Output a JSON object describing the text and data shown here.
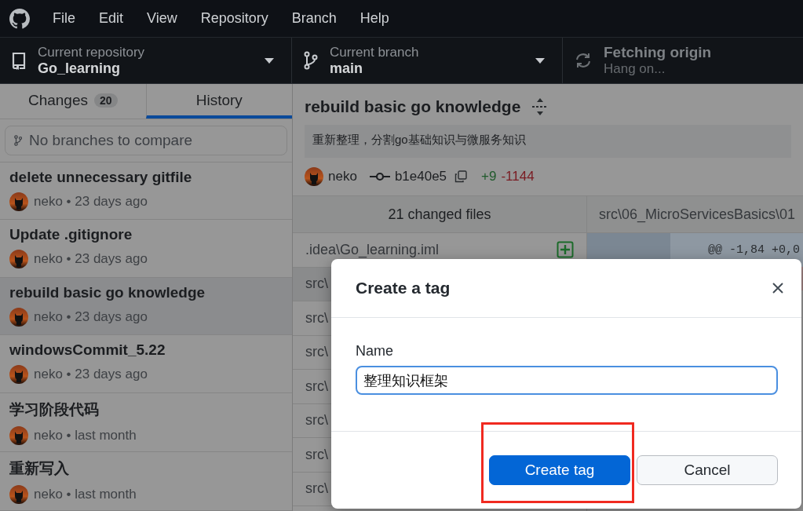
{
  "menu": [
    "File",
    "Edit",
    "View",
    "Repository",
    "Branch",
    "Help"
  ],
  "toolbar": {
    "repository": {
      "label": "Current repository",
      "value": "Go_learning"
    },
    "branch": {
      "label": "Current branch",
      "value": "main"
    },
    "fetch": {
      "label": "Fetching origin",
      "status": "Hang on..."
    }
  },
  "tabs": [
    {
      "label": "Changes",
      "count": "20",
      "selected": false
    },
    {
      "label": "History",
      "selected": true
    }
  ],
  "compare": {
    "placeholder": "No branches to compare"
  },
  "commits": [
    {
      "title": "delete unnecessary gitfile",
      "meta": "neko • 23 days ago",
      "selected": false
    },
    {
      "title": "Update .gitignore",
      "meta": "neko • 23 days ago",
      "selected": false
    },
    {
      "title": "rebuild basic go knowledge",
      "meta": "neko • 23 days ago",
      "selected": true
    },
    {
      "title": "windowsCommit_5.22",
      "meta": "neko • 23 days ago",
      "selected": false
    },
    {
      "title": "学习阶段代码",
      "meta": "neko • last month",
      "selected": false
    },
    {
      "title": "重新写入",
      "meta": "neko • last month",
      "selected": false
    }
  ],
  "commit": {
    "title": "rebuild basic go knowledge",
    "description": "重新整理，分割go基础知识与微服务知识",
    "author": "neko",
    "sha": "b1e40e5",
    "additions": "+9",
    "deletions": "-1144"
  },
  "files": {
    "header": "21 changed files",
    "items": [
      {
        "path": ".idea\\Go_learning.iml",
        "kind": "added",
        "selected": false
      },
      {
        "path": "src\\",
        "selected": true
      },
      {
        "path": "src\\",
        "selected": false
      },
      {
        "path": "src\\",
        "selected": false
      },
      {
        "path": "src\\",
        "selected": false
      },
      {
        "path": "src\\",
        "selected": false
      },
      {
        "path": "src\\",
        "selected": false
      },
      {
        "path": "src\\",
        "selected": false
      }
    ]
  },
  "diff": {
    "path": "src\\06_MicroServicesBasics\\01",
    "hunk": "@@ -1,84 +0,0"
  },
  "dialog": {
    "title": "Create a tag",
    "field_label": "Name",
    "value": "整理知识框架",
    "highlight": true,
    "buttons": [
      {
        "label": "Create tag",
        "kind": "primary"
      },
      {
        "label": "Cancel",
        "kind": "secondary"
      }
    ]
  }
}
